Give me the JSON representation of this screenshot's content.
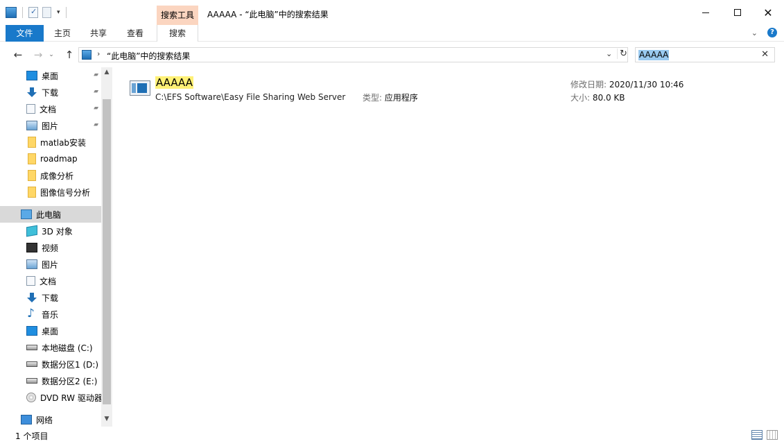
{
  "titlebar": {
    "context_tab_header": "搜索工具",
    "window_title": "AAAAA - “此电脑”中的搜索结果",
    "minimize": "—",
    "maximize": "□",
    "close": "✕"
  },
  "ribbon": {
    "tabs": [
      "文件",
      "主页",
      "共享",
      "查看",
      "搜索"
    ],
    "collapse_glyph": "⌄",
    "help_glyph": "?"
  },
  "address": {
    "back_glyph": "←",
    "forward_glyph": "→",
    "recent_glyph": "⌄",
    "up_glyph": "↑",
    "separator_glyph": "›",
    "path": "“此电脑”中的搜索结果",
    "dropdown_glyph": "⌄",
    "refresh_glyph": "↻"
  },
  "search": {
    "query": "AAAAA",
    "clear_glyph": "✕"
  },
  "navpane": {
    "quick_access": [
      {
        "label": "桌面",
        "icon": "desktop-icon",
        "pinned": true
      },
      {
        "label": "下载",
        "icon": "download-icon",
        "pinned": true
      },
      {
        "label": "文档",
        "icon": "documents-icon",
        "pinned": true
      },
      {
        "label": "图片",
        "icon": "pictures-icon",
        "pinned": true
      },
      {
        "label": "matlab安装",
        "icon": "folder-icon",
        "pinned": false
      },
      {
        "label": "roadmap",
        "icon": "folder-icon",
        "pinned": false
      },
      {
        "label": "成像分析",
        "icon": "folder-icon",
        "pinned": false
      },
      {
        "label": "图像信号分析",
        "icon": "folder-icon",
        "pinned": false
      }
    ],
    "this_pc": {
      "label": "此电脑",
      "icon": "computer-icon"
    },
    "pc_children": [
      {
        "label": "3D 对象",
        "icon": "3d-objects-icon"
      },
      {
        "label": "视频",
        "icon": "videos-icon"
      },
      {
        "label": "图片",
        "icon": "pictures-icon"
      },
      {
        "label": "文档",
        "icon": "documents-icon"
      },
      {
        "label": "下载",
        "icon": "download-icon"
      },
      {
        "label": "音乐",
        "icon": "music-icon"
      },
      {
        "label": "桌面",
        "icon": "desktop-icon"
      },
      {
        "label": "本地磁盘 (C:)",
        "icon": "local-disk-icon"
      },
      {
        "label": "数据分区1 (D:)",
        "icon": "drive-icon"
      },
      {
        "label": "数据分区2 (E:)",
        "icon": "drive-icon"
      },
      {
        "label": "DVD RW 驱动器",
        "icon": "dvd-drive-icon"
      }
    ],
    "network": {
      "label": "网络",
      "icon": "network-icon"
    },
    "pin_glyph": "📌",
    "scroll_up_glyph": "▲",
    "scroll_down_glyph": "▼"
  },
  "results": [
    {
      "name": "AAAAA",
      "path": "C:\\EFS Software\\Easy File Sharing Web Server",
      "type_key": "类型:",
      "type_value": "应用程序",
      "date_key": "修改日期:",
      "date_value": "2020/11/30 10:46",
      "size_key": "大小:",
      "size_value": "80.0 KB"
    }
  ],
  "status": {
    "item_count": "1 个项目"
  },
  "colors": {
    "accent": "#1979ca",
    "context_tab": "#fbd5c0",
    "highlight": "#fff176",
    "selection": "#99c9ef"
  }
}
